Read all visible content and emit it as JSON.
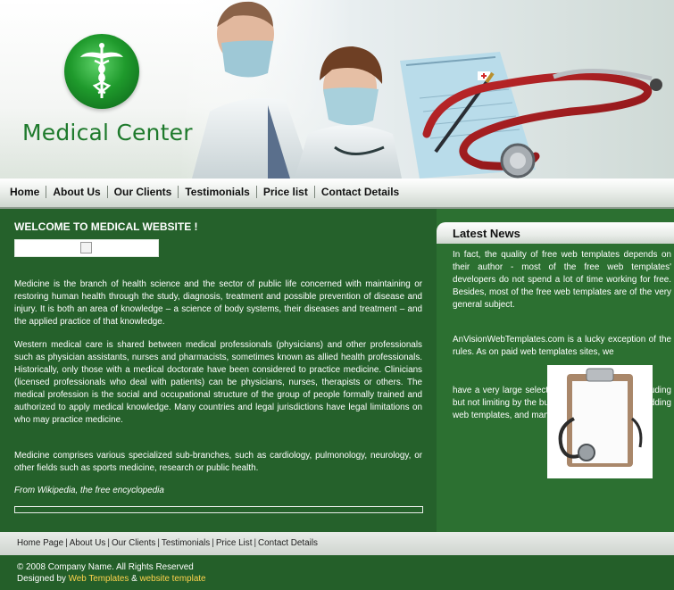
{
  "header": {
    "site_title": "Medical Center"
  },
  "nav": {
    "items": [
      "Home",
      "About Us",
      "Our Clients",
      "Testimonials",
      "Price list",
      "Contact Details"
    ]
  },
  "main": {
    "welcome": "WELCOME TO MEDICAL WEBSITE !",
    "paragraphs": [
      "Medicine is the branch of health science and the sector of public life concerned with maintaining or restoring human health through the study, diagnosis, treatment and possible prevention of disease and injury. It is both an area of knowledge – a science of body systems, their diseases and treatment – and the applied practice of that knowledge.",
      "Western medical care is shared between medical professionals (physicians) and other professionals such as physician assistants, nurses and pharmacists, sometimes known as allied health professionals. Historically, only those with a medical doctorate have been considered to practice medicine. Clinicians (licensed professionals who deal with patients) can be physicians, nurses, therapists or others. The medical profession is the social and occupational structure of the group of people formally trained and authorized to apply medical knowledge. Many countries and legal jurisdictions have legal limitations on who may practice medicine.",
      "Medicine comprises various specialized sub-branches, such as cardiology, pulmonology, neurology, or other fields such as sports medicine, research or public health.",
      "From Wikipedia, the free encyclopedia"
    ]
  },
  "sidebar": {
    "title": "Latest News",
    "news1": "In fact, the quality of free web templates depends on their author - most of the free web templates' developers do not spend a lot of time working for free. Besides, most of the free web templates are of the very general subject.",
    "news2": "AnVisionWebTemplates.com is a lucky exception of the rules. As on paid web templates sites, we",
    "news3": "have a very large selection of web templates, including but not limiting by the business web templates, wedding web templates, and many others."
  },
  "footer_nav": {
    "items": [
      "Home Page",
      "About Us",
      "Our Clients",
      "Testimonials",
      "Price List",
      "Contact Details"
    ],
    "separator": "|"
  },
  "footer": {
    "copyright": "© 2008 Company Name. All Rights Reserved",
    "designed_by": "Designed by",
    "link1": "Web Templates",
    "amp": "&",
    "link2": "website template"
  },
  "colors": {
    "primary_green": "#26602a",
    "accent_yellow": "#ffd34d",
    "logo_green": "#1e7a2c"
  }
}
